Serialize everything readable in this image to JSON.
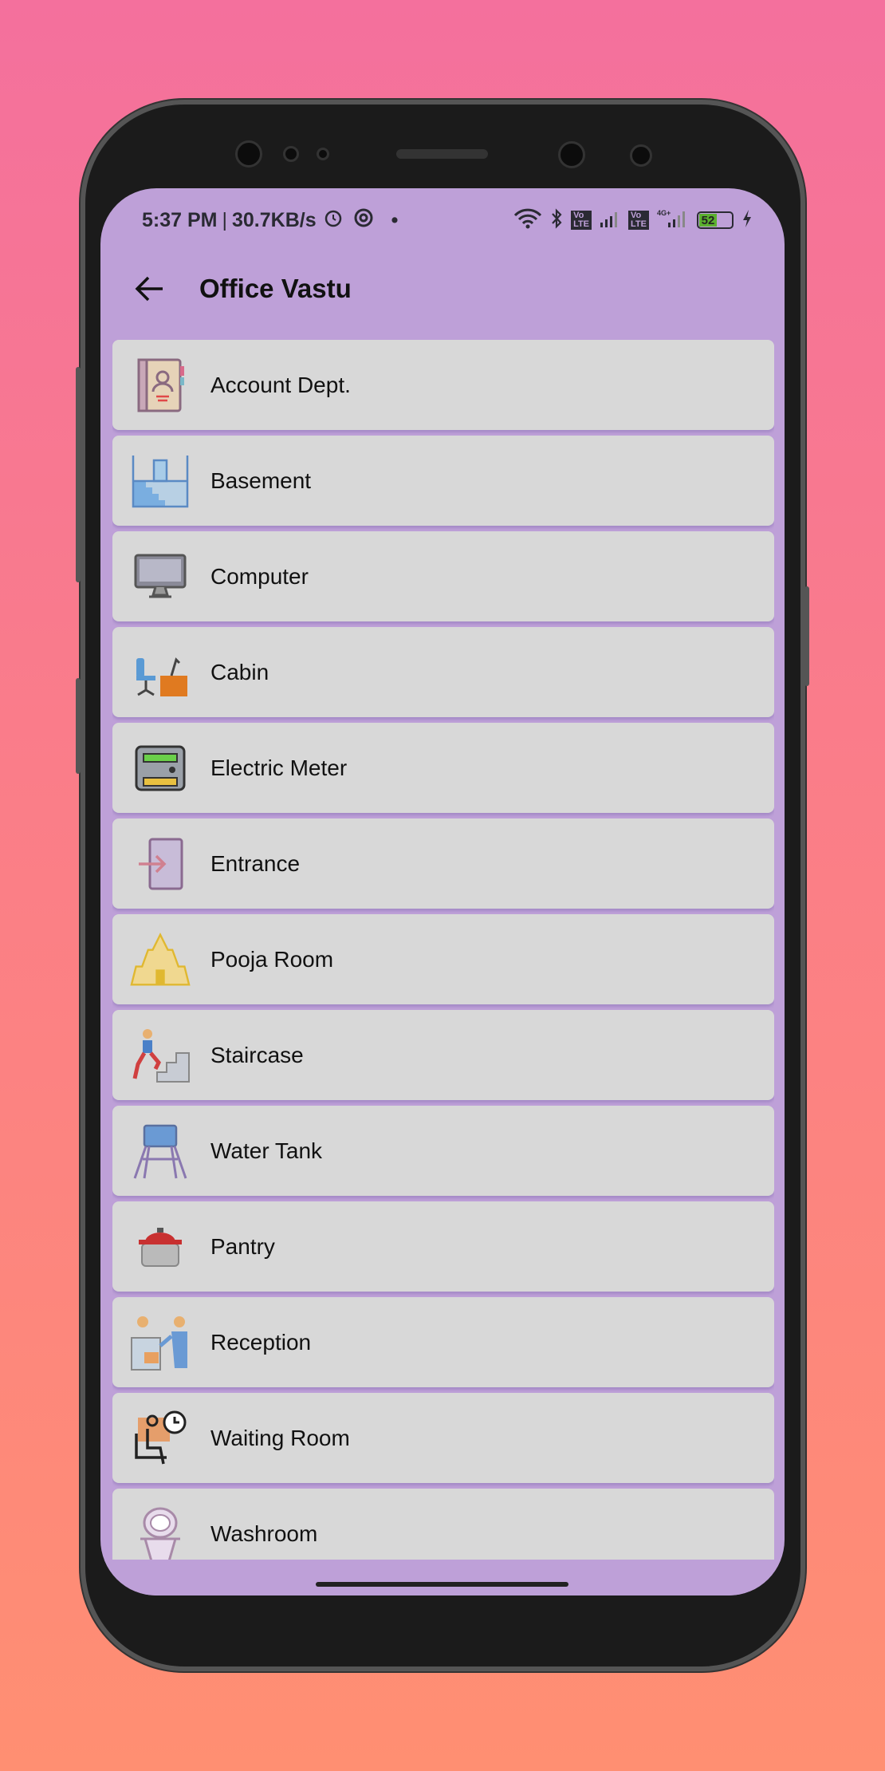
{
  "status_bar": {
    "time": "5:37 PM",
    "speed": "30.7KB/s",
    "battery": "52",
    "icons": [
      "alarm-icon",
      "data-saver-icon",
      "wifi-icon",
      "bluetooth-icon",
      "volte-icon",
      "signal-icon",
      "volte-icon",
      "4g-signal-icon",
      "battery-icon",
      "charging-icon"
    ]
  },
  "header": {
    "title": "Office Vastu",
    "back_icon": "arrow-left-icon"
  },
  "items": [
    {
      "label": "Account Dept.",
      "icon": "address-book-icon"
    },
    {
      "label": "Basement",
      "icon": "basement-stairs-icon"
    },
    {
      "label": "Computer",
      "icon": "desktop-computer-icon"
    },
    {
      "label": "Cabin",
      "icon": "office-desk-icon"
    },
    {
      "label": "Electric Meter",
      "icon": "electric-meter-icon"
    },
    {
      "label": "Entrance",
      "icon": "entrance-door-icon"
    },
    {
      "label": "Pooja Room",
      "icon": "temple-icon"
    },
    {
      "label": "Staircase",
      "icon": "person-climbing-stairs-icon"
    },
    {
      "label": "Water Tank",
      "icon": "water-tower-icon"
    },
    {
      "label": "Pantry",
      "icon": "cooking-pot-icon"
    },
    {
      "label": "Reception",
      "icon": "reception-desk-icon"
    },
    {
      "label": "Waiting Room",
      "icon": "person-waiting-clock-icon"
    },
    {
      "label": "Washroom",
      "icon": "toilet-icon"
    }
  ],
  "colors": {
    "app_bar": "#bea0d8",
    "item_bg": "#d8d8d8",
    "battery_fill": "#5bb02f"
  }
}
